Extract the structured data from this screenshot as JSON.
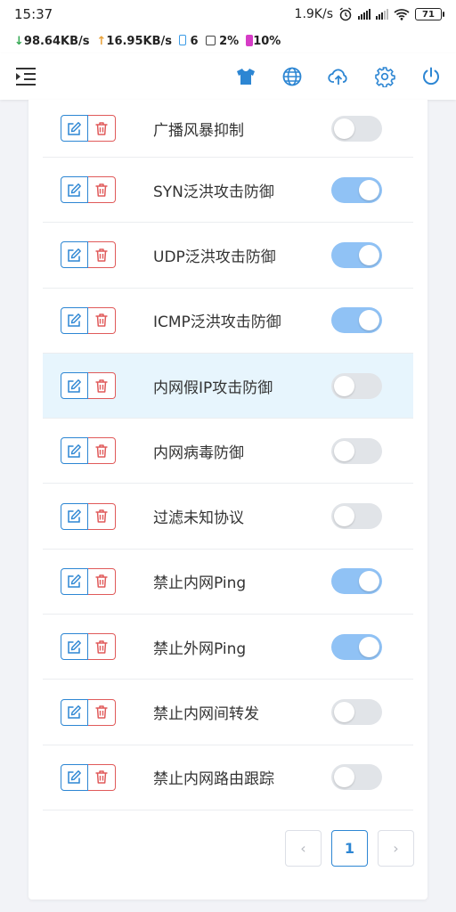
{
  "status": {
    "time": "15:37",
    "speed": "1.9K/s",
    "battery": "71"
  },
  "netbar": {
    "down": "98.64KB/s",
    "up": "16.95KB/s",
    "devices": "6",
    "cpu": "2%",
    "battery": "10%"
  },
  "toolbar": {
    "icons": [
      "menu-icon",
      "tshirt-icon",
      "globe-icon",
      "cloud-upload-icon",
      "gear-icon",
      "power-icon"
    ],
    "accent": "#2d86d3"
  },
  "rules": [
    {
      "label": "广播风暴抑制",
      "enabled": false
    },
    {
      "label": "SYN泛洪攻击防御",
      "enabled": true
    },
    {
      "label": "UDP泛洪攻击防御",
      "enabled": true
    },
    {
      "label": "ICMP泛洪攻击防御",
      "enabled": true
    },
    {
      "label": "内网假IP攻击防御",
      "enabled": false
    },
    {
      "label": "内网病毒防御",
      "enabled": false
    },
    {
      "label": "过滤未知协议",
      "enabled": false
    },
    {
      "label": "禁止内网Ping",
      "enabled": true
    },
    {
      "label": "禁止外网Ping",
      "enabled": true
    },
    {
      "label": "禁止内网间转发",
      "enabled": false
    },
    {
      "label": "禁止内网路由跟踪",
      "enabled": false
    }
  ],
  "pagination": {
    "prev": "‹",
    "current": "1",
    "next": "›"
  },
  "colors": {
    "toggle_on": "#90c2f5",
    "toggle_off": "#e1e4e8",
    "edit": "#2d86d3",
    "delete": "#e05a5a",
    "highlight": "#e7f5fd"
  }
}
